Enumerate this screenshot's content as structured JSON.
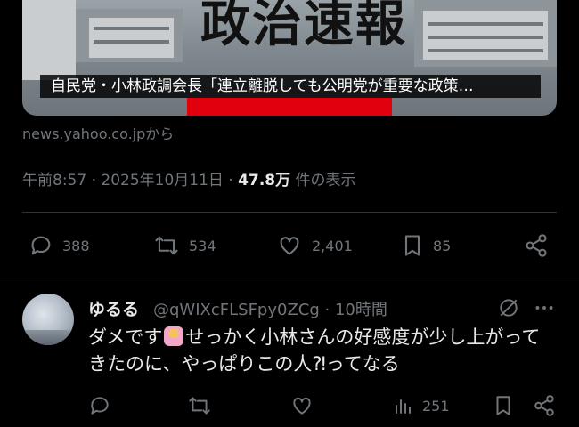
{
  "card": {
    "image_text": "政治速報",
    "caption": "自民党・小林政調会長「連立離脱しても公明党が重要な政策…",
    "source": "news.yahoo.co.jpから"
  },
  "tweet": {
    "time": "午前8:57",
    "sep1": "·",
    "date": "2025年10月11日",
    "sep2": "·",
    "views": "47.8万",
    "views_suffix": "件の表示",
    "replies": "388",
    "reposts": "534",
    "likes": "2,401",
    "bookmarks": "85"
  },
  "reply": {
    "name": "ゆるる",
    "handle": "@qWIXcFLSFpy0ZCg · 10時間",
    "text_before": "ダメです",
    "text_after": "せっかく小林さんの好感度が少し上がってきたのに、やっぱりこの人⁈ってなる",
    "views": "251"
  },
  "icons": {
    "reply": "speech-bubble-icon",
    "repost": "repost-arrows-icon",
    "like": "heart-icon",
    "bookmark": "bookmark-icon",
    "share": "share-icon",
    "grok": "grok-slash-icon",
    "more": "more-dots-icon",
    "views": "bar-chart-icon",
    "emoji": "person-gesturing-no-emoji"
  },
  "colors": {
    "background": "#000000",
    "text": "#e7e9ea",
    "muted": "#71767b",
    "divider": "#2f3336",
    "caption_accent": "#e0000e"
  }
}
